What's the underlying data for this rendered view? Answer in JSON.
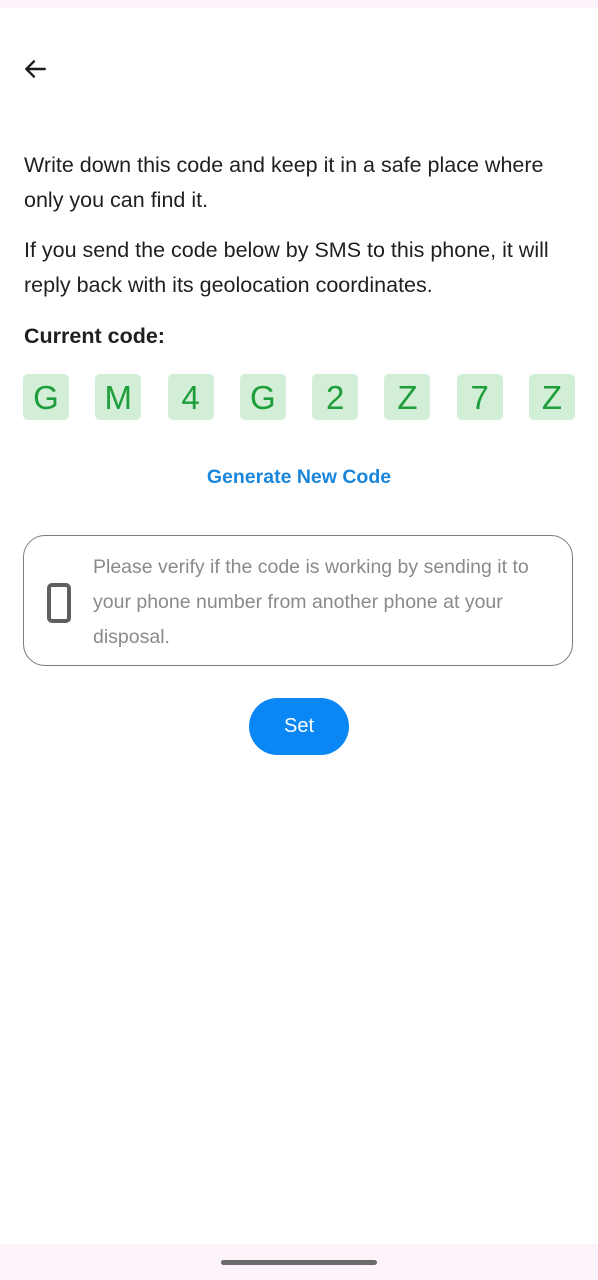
{
  "navigation": {
    "back_icon": "arrow-left-icon"
  },
  "instructions": {
    "line1": "Write down this code and keep it in a safe place where only you can find it.",
    "line2": "If you send the code below by SMS to this phone, it will reply back with its geolocation coordinates."
  },
  "code": {
    "label": "Current code:",
    "chars": [
      "G",
      "M",
      "4",
      "G",
      "2",
      "Z",
      "7",
      "Z"
    ],
    "char_color": "#1e9e3a",
    "tile_color": "#d3eed6"
  },
  "generate": {
    "label": "Generate New Code",
    "color": "#1a86db"
  },
  "info": {
    "icon": "smartphone-icon",
    "text": "Please verify if the code is working by sending it to your phone number from another phone at your disposal."
  },
  "actions": {
    "set_label": "Set",
    "set_color": "#0a86f5"
  }
}
